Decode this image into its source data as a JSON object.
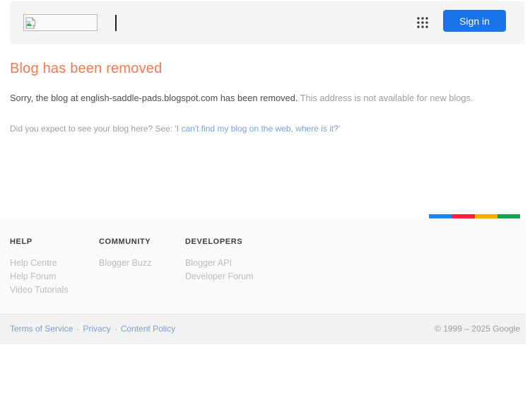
{
  "header": {
    "signin_label": "Sign in"
  },
  "main": {
    "title": "Blog has been removed",
    "message_primary": "Sorry, the blog at english-saddle-pads.blogspot.com has been removed.",
    "message_secondary": "This address is not available for new blogs.",
    "help_prompt": "Did you expect to see your blog here? See: ",
    "help_link": "'I can't find my blog on the web, where is it?'"
  },
  "footer": {
    "columns": [
      {
        "heading": "HELP",
        "links": [
          "Help Centre",
          "Help Forum",
          "Video Tutorials"
        ]
      },
      {
        "heading": "COMMUNITY",
        "links": [
          "Blogger Buzz"
        ]
      },
      {
        "heading": "DEVELOPERS",
        "links": [
          "Blogger API",
          "Developer Forum"
        ]
      }
    ],
    "legal_links": [
      "Terms of Service",
      "Privacy",
      "Content Policy"
    ],
    "separator": "·",
    "copyright": "© 1999 – 2025 Google"
  },
  "icons": {
    "broken_image": "broken-image-icon",
    "apps_grid": "apps-grid-icon"
  },
  "colors": {
    "accent_bar": [
      "#1d87f2",
      "#f6233c",
      "#fdab00",
      "#17a24c"
    ],
    "signin_bg": "#1a73e8",
    "title_orange": "#f4794f",
    "link_blue": "#7b9ed2",
    "header_bg": "#f5f5f5"
  }
}
